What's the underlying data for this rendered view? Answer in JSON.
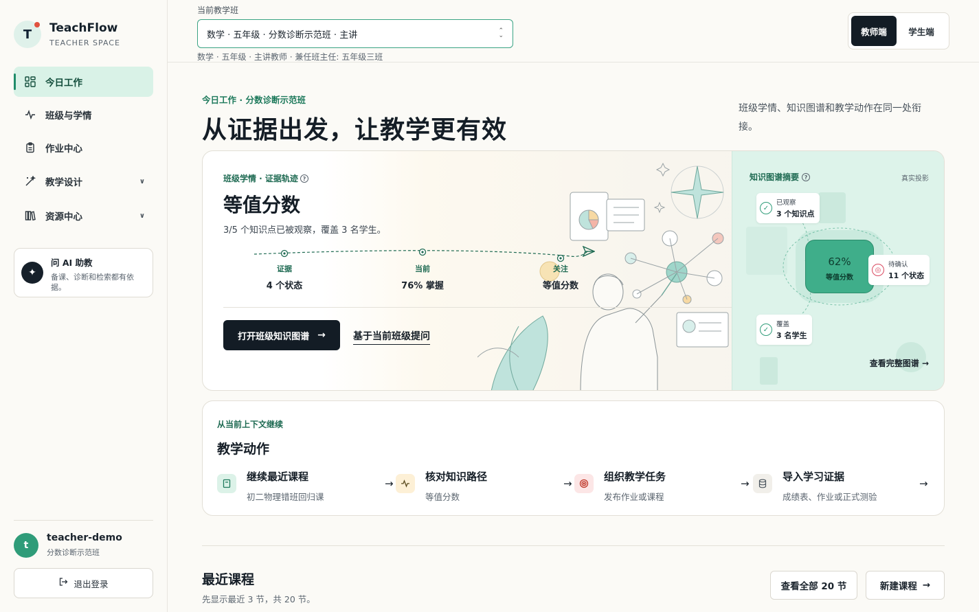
{
  "brand": {
    "logo_letter": "T",
    "name": "TeachFlow",
    "subtitle": "TEACHER SPACE"
  },
  "nav": [
    {
      "label": "今日工作",
      "icon": "dashboard-icon",
      "active": true
    },
    {
      "label": "班级与学情",
      "icon": "pulse-icon"
    },
    {
      "label": "作业中心",
      "icon": "clipboard-icon"
    },
    {
      "label": "教学设计",
      "icon": "magic-wand-icon",
      "expandable": true
    },
    {
      "label": "资源中心",
      "icon": "library-icon",
      "expandable": true
    }
  ],
  "ai_assistant": {
    "title": "问 AI 助教",
    "description": "备课、诊断和检索都有依据。"
  },
  "user": {
    "avatar_letter": "t",
    "name": "teacher-demo",
    "class": "分数诊断示范班",
    "logout_label": "退出登录"
  },
  "topbar": {
    "class_label": "当前教学班",
    "class_value": "数学 · 五年级 · 分数诊断示范班 · 主讲",
    "class_meta": "数学 · 五年级 · 主讲教师 · 兼任班主任: 五年级三班",
    "role_teacher": "教师端",
    "role_student": "学生端"
  },
  "hero": {
    "eyebrow": "今日工作 · 分数诊断示范班",
    "title": "从证据出发，让教学更有效",
    "description": "班级学情、知识图谱和教学动作在同一处衔接。"
  },
  "hero_card": {
    "eyebrow": "班级学情 · 证据轨迹",
    "title": "等值分数",
    "subtitle": "3/5 个知识点已被观察，覆盖 3 名学生。",
    "steps": [
      {
        "label": "证据",
        "value": "4 个状态"
      },
      {
        "label": "当前",
        "value": "76% 掌握"
      },
      {
        "label": "关注",
        "value": "等值分数"
      }
    ],
    "primary_button": "打开班级知识图谱",
    "secondary_link": "基于当前班级提问"
  },
  "knowledge_graph": {
    "title": "知识图谱摘要",
    "tag": "真实投影",
    "observed": {
      "label": "已观察",
      "value": "3 个知识点"
    },
    "pending": {
      "label": "待确认",
      "value": "11 个状态"
    },
    "covered": {
      "label": "覆盖",
      "value": "3 名学生"
    },
    "center": {
      "percent": "62%",
      "name": "等值分数"
    },
    "more_link": "查看完整图谱"
  },
  "actions": {
    "eyebrow": "从当前上下文继续",
    "title": "教学动作",
    "items": [
      {
        "name": "继续最近课程",
        "desc": "初二物理错班回归课",
        "icon": "book-icon",
        "bg": "#dcf2e8",
        "fg": "#1e7a5c"
      },
      {
        "name": "核对知识路径",
        "desc": "等值分数",
        "icon": "pulse-icon",
        "bg": "#fdf0d6",
        "fg": "#8a6a1e"
      },
      {
        "name": "组织教学任务",
        "desc": "发布作业或课程",
        "icon": "target-icon",
        "bg": "#fce6e6",
        "fg": "#c0392b"
      },
      {
        "name": "导入学习证据",
        "desc": "成绩表、作业或正式测验",
        "icon": "database-icon",
        "bg": "#f1efea",
        "fg": "#4a545d"
      }
    ]
  },
  "recent": {
    "title": "最近课程",
    "subtitle": "先显示最近 3 节，共 20 节。",
    "view_all": "查看全部 20 节",
    "new_course": "新建课程"
  },
  "colors": {
    "accent": "#1e7a5c",
    "accent_light": "#d9f2e7",
    "dark": "#131c25",
    "graph_center": "#3fae8a"
  }
}
